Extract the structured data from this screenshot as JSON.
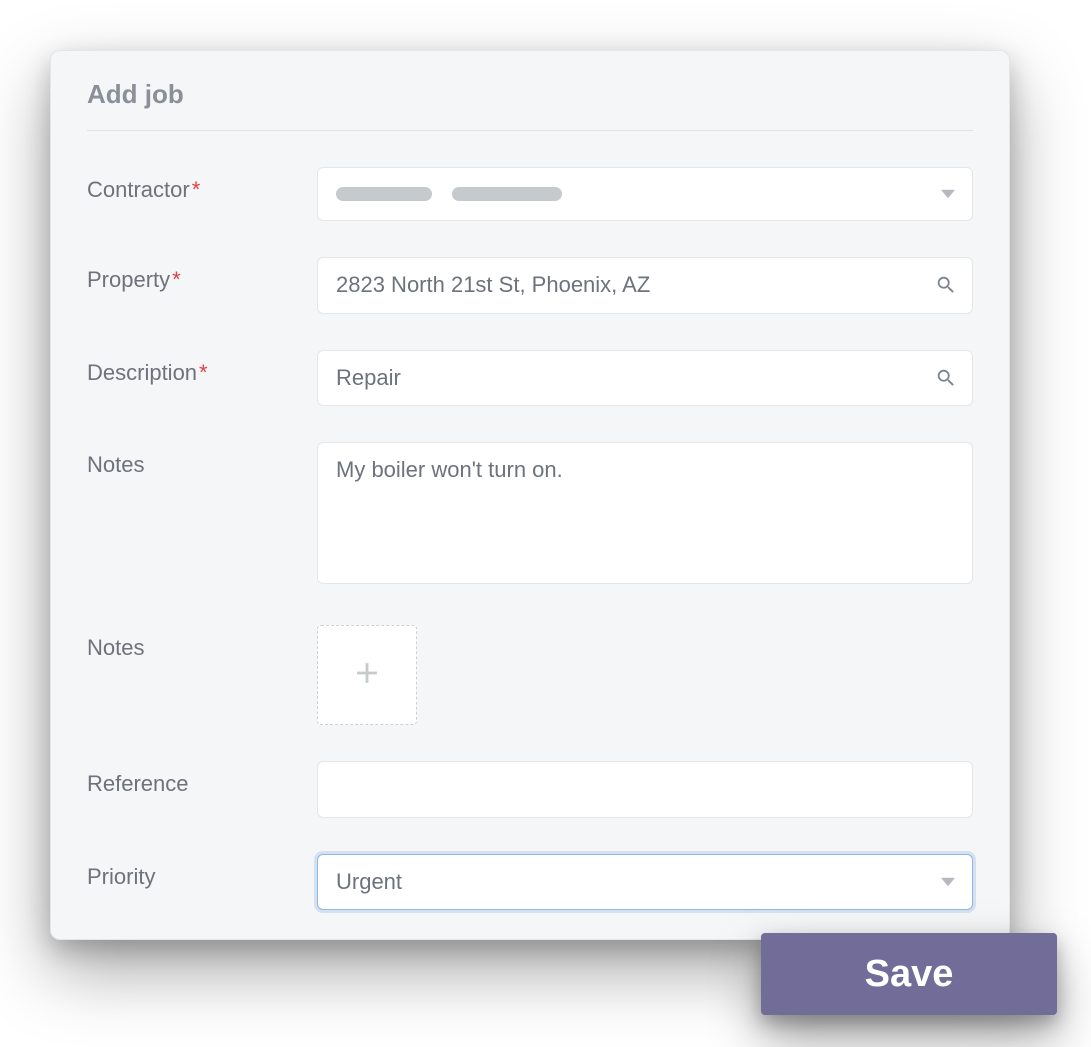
{
  "title": "Add job",
  "fields": {
    "contractor": {
      "label": "Contractor",
      "required": true
    },
    "property": {
      "label": "Property",
      "required": true,
      "value": "2823 North 21st St, Phoenix, AZ"
    },
    "description": {
      "label": "Description",
      "required": true,
      "value": "Repair"
    },
    "notes": {
      "label": "Notes",
      "value": "My boiler won't turn on."
    },
    "attachments": {
      "label": "Notes"
    },
    "reference": {
      "label": "Reference",
      "value": ""
    },
    "priority": {
      "label": "Priority",
      "value": "Urgent"
    }
  },
  "saveLabel": "Save"
}
